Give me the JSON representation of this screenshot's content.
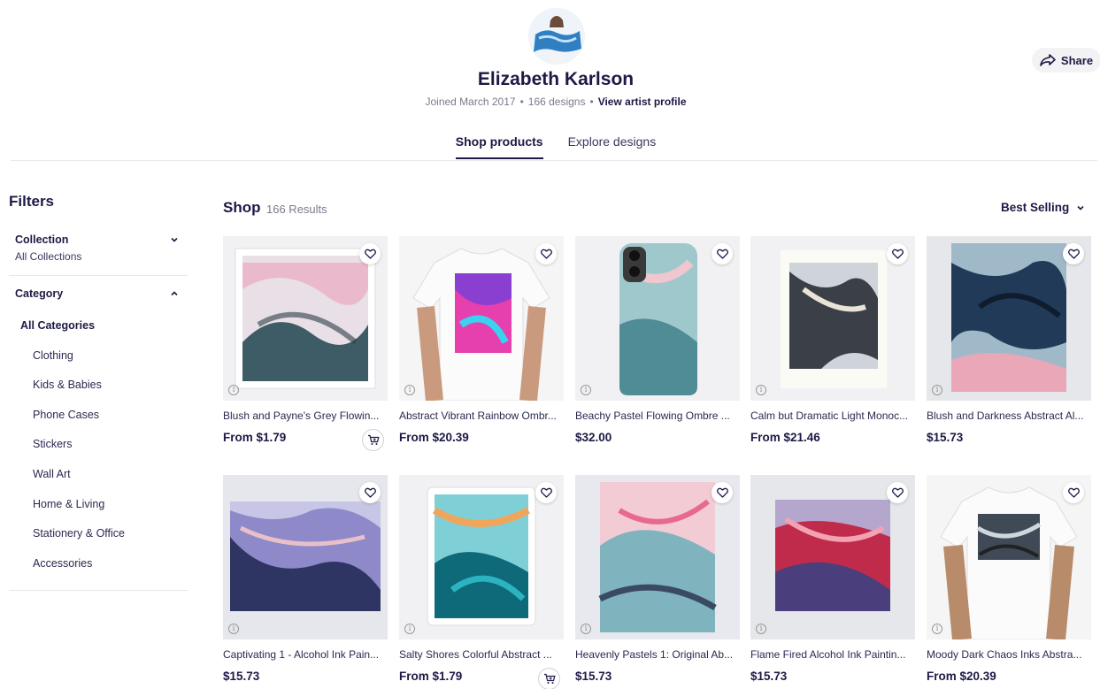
{
  "profile": {
    "name": "Elizabeth Karlson",
    "joined": "Joined March 2017",
    "designs": "166 designs",
    "view_profile": "View artist profile",
    "share_label": "Share"
  },
  "tabs": [
    {
      "label": "Shop products",
      "active": true
    },
    {
      "label": "Explore designs",
      "active": false
    }
  ],
  "filters": {
    "title": "Filters",
    "collection": {
      "label": "Collection",
      "value": "All Collections"
    },
    "category": {
      "label": "Category",
      "items": [
        "All Categories",
        "Clothing",
        "Kids & Babies",
        "Phone Cases",
        "Stickers",
        "Wall Art",
        "Home & Living",
        "Stationery & Office",
        "Accessories"
      ]
    }
  },
  "shop": {
    "title": "Shop",
    "results": "166 Results",
    "sort": "Best Selling"
  },
  "products": [
    {
      "title": "Blush and Payne's Grey Flowin...",
      "price": "From $1.79",
      "cart": true
    },
    {
      "title": "Abstract Vibrant Rainbow Ombr...",
      "price": "From $20.39",
      "cart": false
    },
    {
      "title": "Beachy Pastel Flowing Ombre ...",
      "price": "$32.00",
      "cart": false
    },
    {
      "title": "Calm but Dramatic Light Monoc...",
      "price": "From $21.46",
      "cart": false
    },
    {
      "title": "Blush and Darkness Abstract Al...",
      "price": "$15.73",
      "cart": false
    },
    {
      "title": "Captivating 1 - Alcohol Ink Pain...",
      "price": "$15.73",
      "cart": false
    },
    {
      "title": "Salty Shores Colorful Abstract ...",
      "price": "From $1.79",
      "cart": true
    },
    {
      "title": "Heavenly Pastels 1: Original Ab...",
      "price": "$15.73",
      "cart": false
    },
    {
      "title": "Flame Fired Alcohol Ink Paintin...",
      "price": "$15.73",
      "cart": false
    },
    {
      "title": "Moody Dark Chaos Inks Abstra...",
      "price": "From $20.39",
      "cart": false
    }
  ],
  "icons": {
    "share": "share-arrow-icon",
    "favorite": "heart-icon",
    "cart": "add-to-cart-icon",
    "info": "info-icon",
    "chevron": "chevron-icon"
  },
  "colors": {
    "ink": "#1c1a45",
    "muted": "#7b7a8e",
    "tile_bg": "#f1f1f3"
  }
}
